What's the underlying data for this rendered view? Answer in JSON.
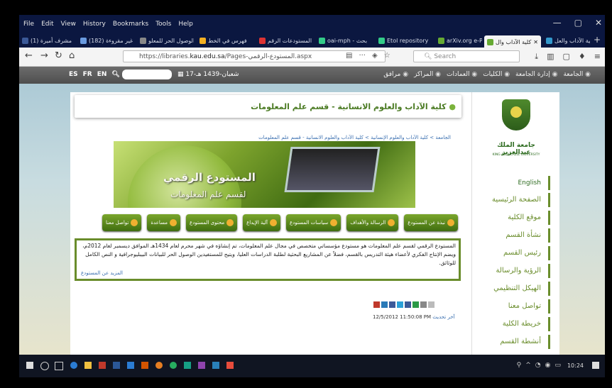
{
  "menubar": [
    "File",
    "Edit",
    "View",
    "History",
    "Bookmarks",
    "Tools",
    "Help"
  ],
  "window_controls": [
    "—",
    "▢",
    "✕"
  ],
  "tabs": [
    {
      "label": "(1) مشرف أميرة",
      "color": "#3b5998",
      "active": false
    },
    {
      "label": "(182) غير مقروءة",
      "color": "#6a9be0",
      "active": false
    },
    {
      "label": "الوصول الحر للمعلو",
      "color": "#888",
      "active": false
    },
    {
      "label": "فهرس في الخط",
      "color": "#f3b022",
      "active": false
    },
    {
      "label": "المستودعات الرقم",
      "color": "#d33",
      "active": false
    },
    {
      "label": "oai-mph - بحث",
      "color": "#3c8",
      "active": false
    },
    {
      "label": "Etol repository",
      "color": "#3c8",
      "active": false
    },
    {
      "label": "arXiv.org e-Print",
      "color": "#6a3",
      "active": false
    },
    {
      "label": "كلية الآداب وال",
      "color": "#6a3",
      "active": true
    },
    {
      "label": "كلية الآداب والعل",
      "color": "#39c",
      "active": false
    }
  ],
  "url": {
    "prefix": "https://libraries.",
    "domain": "kau.edu.sa",
    "path": "/Pages-المستودع-الرقمي.aspx"
  },
  "search_placeholder": "Search",
  "site": {
    "langs": [
      "ES",
      "FR",
      "EN"
    ],
    "date": "17-شعبان-1439 هـ",
    "topmenu": [
      "الجامعة",
      "إدارة الجامعة",
      "الكليات",
      "العمادات",
      "المراكز",
      "مرافق"
    ],
    "title": "كلية الآداب والعلوم الانسانية - قسم علم المعلومات",
    "breadcrumb": "الجامعة > كلية الآداب والعلوم الإنسانية > كلية الآداب والعلوم الانسانية - قسم علم المعلومات",
    "banner_title": "المستودع الرقمي",
    "banner_sub": "لقسم علم المعلومات",
    "icon_buttons": [
      "نبذة عن المستودع",
      "الرسالة والأهداف",
      "سياسات المستودع",
      "آلية الإيداع",
      "محتوى المستودع",
      "مساعدة",
      "تواصل معنا"
    ],
    "description": "المستودع الرقمي لقسم علم المعلومات هو مستودع مؤسساتي متخصص في مجال علم المعلومات، تم إنشاؤه في شهر محرم لعام 1434هـ الموافق ديسمبر لعام 2012م، ويضم الإنتاج الفكري لأعضاء هيئة التدريس بالقسم، فضلاً عن المشاريع البحثية لطلبة الدراسات العليا، ويتيح للمستفيدين الوصول الحر للبيانات البيبليوجرافية و النص الكامل للوثائق.",
    "more_link": "المزيد عن المستودع",
    "last_updated_label": "آخر تحديث",
    "last_updated": "12/5/2012 11:50:08 PM",
    "university": "جامعة الملك عبدالعزيز",
    "university_en": "KING ABDULAZIZ UNIVERSITY",
    "sidebar": [
      "English",
      "الصفحة الرئيسية",
      "موقع الكلية",
      "نشأة القسم",
      "رئيس القسم",
      "الرؤية والرسالة",
      "الهيكل التنظيمي",
      "تواصل معنا",
      "خريطة الكلية",
      "أنشطة القسم"
    ]
  },
  "taskbar": {
    "time": "10:24"
  }
}
